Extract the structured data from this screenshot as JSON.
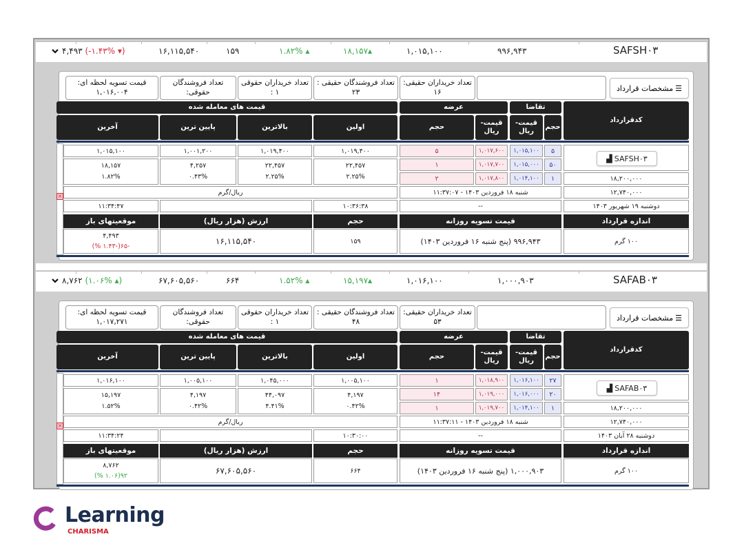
{
  "labels": {
    "contract_specs": "مشخصات قرارداد",
    "buyers_real": "تعداد خریداران حقیقی:",
    "sellers_real": "تعداد فروشندگان حقیقی :",
    "buyers_legal": "تعداد خریداران حقوقی",
    "sellers_legal": "تعداد فروشندگان حقوقی:",
    "instant_settlement": "قیمت تسویه لحظه ای:",
    "traded_prices": "قیمت های معامله شده",
    "ask": "عرضه",
    "bid": "تقاضا",
    "contract_code": "کدقرارداد",
    "last": "آخرین",
    "low": "پایین ترین",
    "high": "بالاترین",
    "first": "اولین",
    "volume": "حجم",
    "price_rial": "قیمت-ریال",
    "open_interest": "موقعیتهای باز",
    "value": "ارزش (هزار ریال)",
    "daily_settlement": "قیمت تسویه روزانه",
    "contract_size": "اندازه قرارداد"
  },
  "colors": {
    "up": "#3aa84a",
    "down": "#d0303a",
    "ask_bg": "#fbe9ee",
    "bid_bg": "#e6e8f8",
    "header_bg": "#222222",
    "brand_purple": "#9b3a96",
    "brand_navy": "#1c2f4f",
    "brand_red": "#d0202a"
  },
  "panels": [
    {
      "summary": {
        "open_interest": "۴,۴۹۳",
        "oi_change": "-۱.۴۳%",
        "oi_dir": "down",
        "value": "۱۶,۱۱۵,۵۴۰",
        "volume": "۱۵۹",
        "change_pct": "۱.۸۲%",
        "change": "۱۸,۱۵۷",
        "last_price": "۱,۰۱۵,۱۰۰",
        "settlement": "۹۹۶,۹۴۳",
        "code": "SAFSH۰۳"
      },
      "info": {
        "buyers_real": "۱۶",
        "sellers_real": "۲۳",
        "buyers_legal": "۱ :",
        "sellers_legal": "۰",
        "instant_settlement": "۱,۰۱۶,۰۰۴"
      },
      "orders": [
        {
          "bid_vol": "۵",
          "bid_price": "۱,۰۱۵,۱۰۰",
          "ask_price": "۱,۰۱۷,۶۰۰",
          "ask_vol": "۵"
        },
        {
          "bid_vol": "۵۰",
          "bid_price": "۱,۰۱۵,۰۰۰",
          "ask_price": "۱,۰۱۷,۷۰۰",
          "ask_vol": "۱"
        },
        {
          "bid_vol": "۱",
          "bid_price": "۱,۰۱۴,۱۰۰",
          "ask_price": "۱,۰۱۷,۸۰۰",
          "ask_vol": "۲"
        }
      ],
      "prices": {
        "first": {
          "value": "۱,۰۱۹,۴۰۰",
          "change": "۲۲,۴۵۷",
          "pct": "۲.۲۵%"
        },
        "high": {
          "value": "۱,۰۱۹,۴۰۰",
          "change": "۲۲,۴۵۷",
          "pct": "۲.۲۵%"
        },
        "low": {
          "value": "۱,۰۰۱,۲۰۰",
          "change": "۴,۲۵۷",
          "pct": "۰.۴۳%"
        },
        "last": {
          "value": "۱,۰۱۵,۱۰۰",
          "change": "۱۸,۱۵۷",
          "pct": "۱.۸۲%"
        }
      },
      "unit": "ریال/گرم",
      "upper_limit": "۱۸,۲۰۰,۰۰۰",
      "lower_limit": "۱۲,۷۴۰,۰۰۰",
      "update_time": "شنبه ۱۸ فروردین ۱۴۰۳ - ۱۱:۳۷:۰۷",
      "expiry": "دوشنبه ۱۹ شهریور ۱۴۰۳",
      "dash": "--",
      "first_trade_time": "۱۰:۳۶:۳۸",
      "last_trade_time": "۱۱:۳۴:۴۷",
      "contract_size": "۱۰۰ گرم",
      "daily_settlement": "۹۹۶,۹۴۳ (پنج شنبه ۱۶ فروردین ۱۴۰۳)",
      "volume": "۱۵۹",
      "value": "۱۶,۱۱۵,۵۴۰",
      "open_interest": "۴,۴۹۳",
      "oi_change": "-۶۵(-۱.۴۳ %)",
      "oi_dir": "down"
    },
    {
      "summary": {
        "open_interest": "۸,۷۶۲",
        "oi_change": "۱.۰۶%",
        "oi_dir": "up",
        "value": "۶۷,۶۰۵,۵۶۰",
        "volume": "۶۶۴",
        "change_pct": "۱.۵۲%",
        "change": "۱۵,۱۹۷",
        "last_price": "۱,۰۱۶,۱۰۰",
        "settlement": "۱,۰۰۰,۹۰۳",
        "code": "SAFAB۰۳"
      },
      "info": {
        "buyers_real": "۵۳",
        "sellers_real": "۴۸",
        "buyers_legal": "۱ :",
        "sellers_legal": "۰",
        "instant_settlement": "۱,۰۱۷,۲۷۱"
      },
      "orders": [
        {
          "bid_vol": "۲۷",
          "bid_price": "۱,۰۱۶,۱۰۰",
          "ask_price": "۱,۰۱۸,۹۰۰",
          "ask_vol": "۱"
        },
        {
          "bid_vol": "۲۰",
          "bid_price": "۱,۰۱۶,۰۰۰",
          "ask_price": "۱,۰۱۹,۰۰۰",
          "ask_vol": "۱۴"
        },
        {
          "bid_vol": "۱",
          "bid_price": "۱,۰۱۴,۱۰۰",
          "ask_price": "۱,۰۱۹,۷۰۰",
          "ask_vol": "۱"
        }
      ],
      "prices": {
        "first": {
          "value": "۱,۰۰۵,۱۰۰",
          "change": "۴,۱۹۷",
          "pct": "۰.۴۲%"
        },
        "high": {
          "value": "۱,۰۴۵,۰۰۰",
          "change": "۴۴,۰۹۷",
          "pct": "۴.۴۱%"
        },
        "low": {
          "value": "۱,۰۰۵,۱۰۰",
          "change": "۴,۱۹۷",
          "pct": "۰.۴۲%"
        },
        "last": {
          "value": "۱,۰۱۶,۱۰۰",
          "change": "۱۵,۱۹۷",
          "pct": "۱.۵۲%"
        }
      },
      "unit": "ریال/گرم",
      "upper_limit": "۱۸,۲۰۰,۰۰۰",
      "lower_limit": "۱۲,۷۴۰,۰۰۰",
      "update_time": "شنبه ۱۸ فروردین ۱۴۰۳ - ۱۱:۳۷:۱۱",
      "expiry": "دوشنبه ۲۸ آبان ۱۴۰۳",
      "dash": "--",
      "first_trade_time": "۱۰:۳۰:۰۰",
      "last_trade_time": "۱۱:۳۴:۲۴",
      "contract_size": "۱۰۰ گرم",
      "daily_settlement": "۱,۰۰۰,۹۰۳ (پنج شنبه ۱۶ فروردین ۱۴۰۳)",
      "volume": "۶۶۴",
      "value": "۶۷,۶۰۵,۵۶۰",
      "open_interest": "۸,۷۶۲",
      "oi_change": "۹۲(۱.۰۶ %)",
      "oi_dir": "up"
    }
  ],
  "logo": {
    "name": "Learning",
    "sub": "CHARISMA"
  }
}
